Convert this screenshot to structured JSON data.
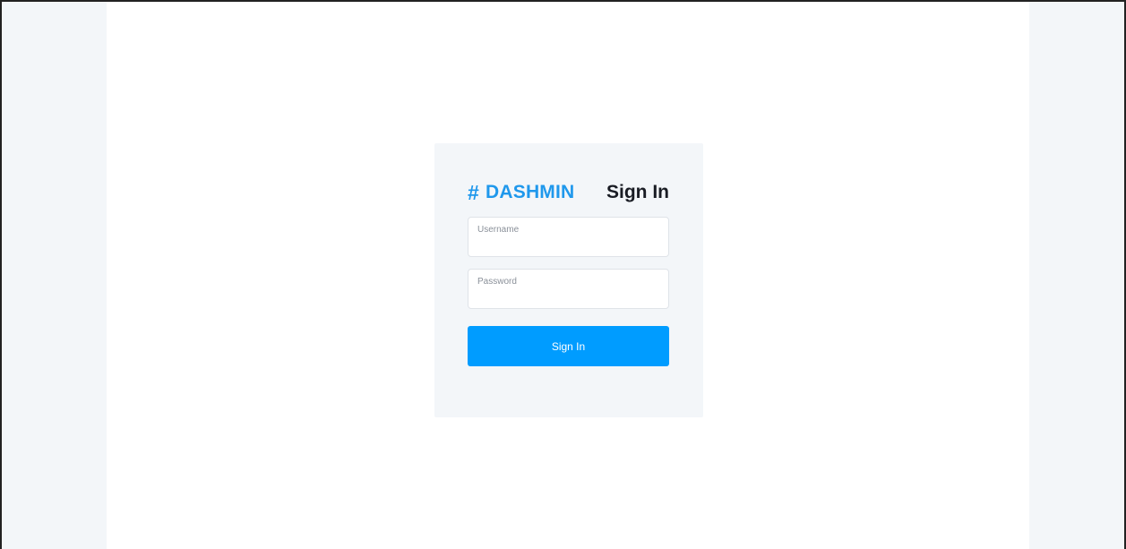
{
  "theme": {
    "primary_color": "#009cff",
    "brand_color": "#1f98ec",
    "page_background": "#f3f6f9",
    "card_background": "#f3f6f9"
  },
  "brand": {
    "icon": "hashtag-icon",
    "icon_glyph": "#",
    "name": "DASHMIN"
  },
  "form": {
    "title": "Sign In",
    "username": {
      "label": "Username",
      "value": ""
    },
    "password": {
      "label": "Password",
      "value": ""
    },
    "submit_label": "Sign In"
  }
}
